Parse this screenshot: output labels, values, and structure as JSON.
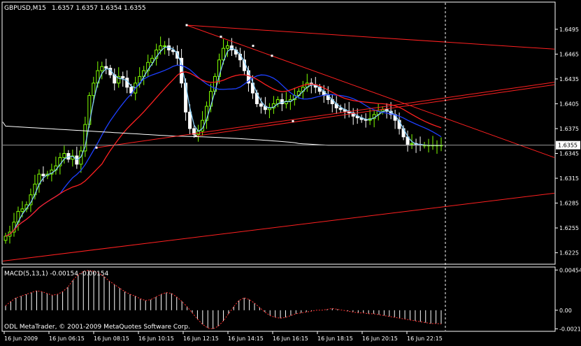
{
  "header": {
    "symbol": "GBPUSD,M15",
    "ohlc": "1.6357 1.6357 1.6354 1.6355"
  },
  "macd_header": {
    "label": "MACD(5,13,1) -0.00154 -0.00154"
  },
  "footer": {
    "copyright": "ODL MetaTrader, © 2001-2009 MetaQuotes Software Corp."
  },
  "colors": {
    "background": "#000000",
    "frame": "#ffffff",
    "bull_candle": "#7fff00",
    "bear_candle": "#ffffff",
    "ma_fast": "#87cefa",
    "ma_mid": "#1e40ff",
    "ma_slow": "#ff2020",
    "ma_long": "#ffffff",
    "trendline": "#ff2020",
    "signal": "#ff3030",
    "grid_marker": "#ff4040"
  },
  "chart_data": [
    {
      "type": "candlestick",
      "symbol": "GBPUSD",
      "timeframe": "M15",
      "ylim": [
        1.6212,
        1.6527
      ],
      "y_ticks": [
        "1.6495",
        "1.6465",
        "1.6435",
        "1.6405",
        "1.6375",
        "1.6345",
        "1.6315",
        "1.6285",
        "1.6255",
        "1.6225"
      ],
      "current_price_label": "1.6355",
      "current_price": 1.6355,
      "x_tick_labels": [
        "16 Jun 2009",
        "16 Jun 06:15",
        "16 Jun 08:15",
        "16 Jun 10:15",
        "16 Jun 12:15",
        "16 Jun 14:15",
        "16 Jun 16:15",
        "16 Jun 18:15",
        "16 Jun 20:15",
        "16 Jun 22:15"
      ],
      "bars": 105,
      "close_path": [
        1.6245,
        1.625,
        1.6262,
        1.6275,
        1.6278,
        1.6283,
        1.6295,
        1.6308,
        1.632,
        1.6318,
        1.632,
        1.6325,
        1.633,
        1.634,
        1.6345,
        1.6338,
        1.6342,
        1.6332,
        1.6348,
        1.638,
        1.6415,
        1.643,
        1.6445,
        1.645,
        1.6448,
        1.644,
        1.643,
        1.6438,
        1.6436,
        1.6425,
        1.6418,
        1.643,
        1.6438,
        1.6445,
        1.6455,
        1.646,
        1.647,
        1.6475,
        1.6475,
        1.647,
        1.6468,
        1.646,
        1.643,
        1.6395,
        1.6375,
        1.6368,
        1.6372,
        1.6385,
        1.6402,
        1.642,
        1.6438,
        1.6458,
        1.6472,
        1.6475,
        1.647,
        1.6465,
        1.6458,
        1.6445,
        1.643,
        1.6418,
        1.6405,
        1.6402,
        1.6398,
        1.64,
        1.6405,
        1.641,
        1.6405,
        1.6408,
        1.641,
        1.6415,
        1.642,
        1.6425,
        1.643,
        1.6428,
        1.6425,
        1.642,
        1.6415,
        1.641,
        1.6405,
        1.64,
        1.6398,
        1.6396,
        1.6394,
        1.639,
        1.6388,
        1.6386,
        1.6385,
        1.6387,
        1.6392,
        1.6396,
        1.6398,
        1.6396,
        1.6392,
        1.6385,
        1.6375,
        1.6365,
        1.6356,
        1.6357,
        1.6356,
        1.6355,
        1.6355,
        1.6355,
        1.6355,
        1.6355,
        1.6355
      ],
      "indicators": [
        {
          "name": "MA fast",
          "color_key": "ma_fast"
        },
        {
          "name": "MA mid",
          "color_key": "ma_mid"
        },
        {
          "name": "MA slow",
          "color_key": "ma_slow"
        },
        {
          "name": "MA long",
          "color_key": "ma_long"
        }
      ],
      "trendlines": 5
    },
    {
      "type": "histogram",
      "name": "MACD(5,13,1)",
      "ylim": [
        -0.0023,
        0.0048
      ],
      "y_ticks": [
        "0.00454",
        "0.00",
        "-0.0021"
      ],
      "macd_value": -0.00154,
      "signal_value": -0.00154,
      "values": [
        0.0005,
        0.001,
        0.0014,
        0.0016,
        0.0018,
        0.002,
        0.0022,
        0.0021,
        0.0019,
        0.0017,
        0.0018,
        0.0021,
        0.0026,
        0.0034,
        0.004,
        0.0044,
        0.0045,
        0.0044,
        0.0042,
        0.0038,
        0.0033,
        0.0029,
        0.0025,
        0.0021,
        0.0018,
        0.0016,
        0.0013,
        0.0011,
        0.0012,
        0.0015,
        0.0018,
        0.002,
        0.0019,
        0.0015,
        0.001,
        0.0004,
        -0.0003,
        -0.001,
        -0.0016,
        -0.002,
        -0.0021,
        -0.0018,
        -0.0012,
        -0.0004,
        0.0004,
        0.0011,
        0.0014,
        0.0012,
        0.0008,
        0.0003,
        -0.0002,
        -0.0006,
        -0.0008,
        -0.0009,
        -0.0008,
        -0.0006,
        -0.0004,
        -0.0003,
        -0.0002,
        -0.0001,
        0,
        0,
        0.0001,
        0.0002,
        0.0001,
        0,
        -0.0001,
        -0.0002,
        -0.0003,
        -0.0003,
        -0.0004,
        -0.0004,
        -0.0005,
        -0.0006,
        -0.0007,
        -0.0008,
        -0.0009,
        -0.001,
        -0.0011,
        -0.0012,
        -0.0013,
        -0.0014,
        -0.0015,
        -0.0015,
        -0.00154
      ]
    }
  ]
}
